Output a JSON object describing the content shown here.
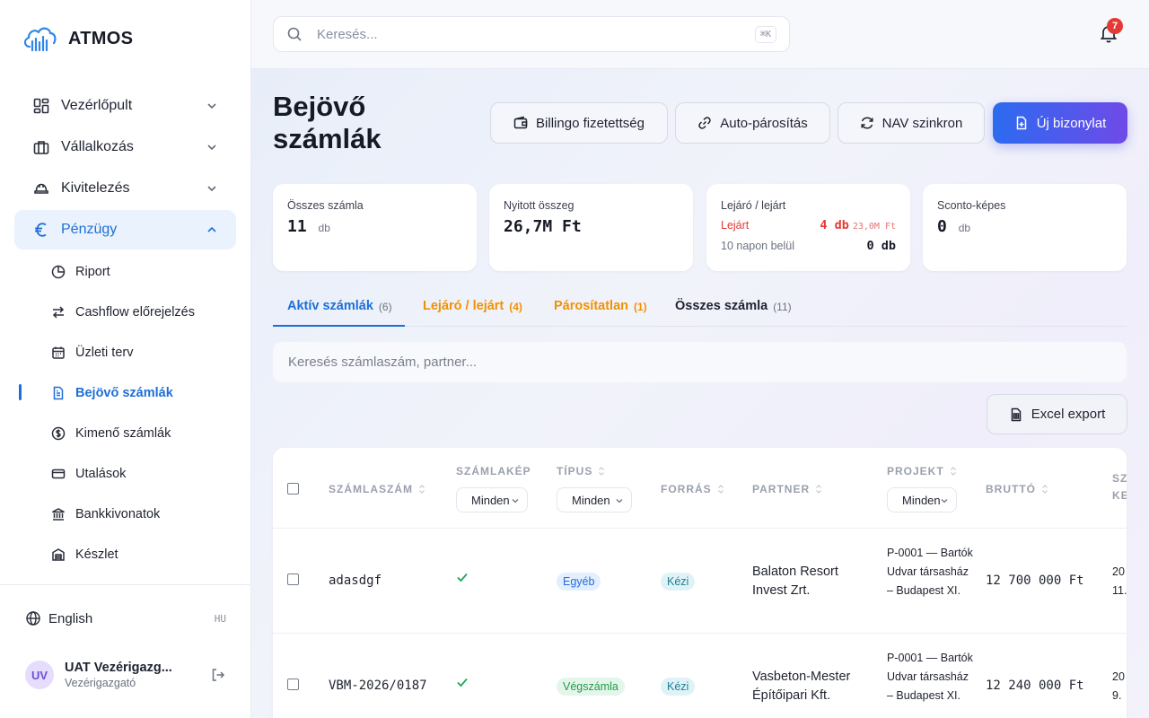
{
  "app": {
    "name": "ATMOS"
  },
  "sidebar": {
    "nav": [
      {
        "label": "Vezérlőpult"
      },
      {
        "label": "Vállalkozás"
      },
      {
        "label": "Kivitelezés"
      },
      {
        "label": "Pénzügy"
      }
    ],
    "sub": [
      {
        "label": "Riport"
      },
      {
        "label": "Cashflow előrejelzés"
      },
      {
        "label": "Üzleti terv"
      },
      {
        "label": "Bejövő számlák"
      },
      {
        "label": "Kimenő számlák"
      },
      {
        "label": "Utalások"
      },
      {
        "label": "Bankkivonatok"
      },
      {
        "label": "Készlet"
      }
    ],
    "language": {
      "label": "English",
      "code": "HU"
    },
    "user": {
      "initials": "UV",
      "name": "UAT Vezérigazg...",
      "role": "Vezérigazgató"
    }
  },
  "topbar": {
    "search_placeholder": "Keresés...",
    "shortcut": "⌘K",
    "notifications": "7"
  },
  "page": {
    "title": "Bejövő számlák",
    "buttons": {
      "billingo": "Billingo fizetettség",
      "auto": "Auto-párosítás",
      "nav": "NAV szinkron",
      "new": "Új bizonylat"
    }
  },
  "cards": {
    "total": {
      "label": "Összes számla",
      "value": "11",
      "unit": "db"
    },
    "open": {
      "label": "Nyitott összeg",
      "value": "26,7M Ft"
    },
    "due": {
      "label": "Lejáró / lejárt",
      "expired_label": "Lejárt",
      "expired_value": "4 db",
      "expired_amount": "23,0M Ft",
      "soon_label": "10 napon belül",
      "soon_value": "0 db"
    },
    "sconto": {
      "label": "Sconto-képes",
      "value": "0",
      "unit": "db"
    }
  },
  "tabs": [
    {
      "label": "Aktív számlák",
      "count": "(6)"
    },
    {
      "label": "Lejáró / lejárt",
      "count": "(4)"
    },
    {
      "label": "Párosítatlan",
      "count": "(1)"
    },
    {
      "label": "Összes számla",
      "count": "(11)"
    }
  ],
  "filter": {
    "placeholder": "Keresés számlaszám, partner..."
  },
  "export_label": "Excel export",
  "table": {
    "headers": {
      "number": "SZÁMLASZÁM",
      "image": "SZÁMLAKÉP",
      "type": "TÍPUS",
      "source": "FORRÁS",
      "partner": "PARTNER",
      "project": "PROJEKT",
      "gross": "BRUTTÓ",
      "next": "SZ",
      "next2": "KE"
    },
    "filters": {
      "image": "Minden",
      "type": "Minden",
      "project": "Minden"
    },
    "rows": [
      {
        "number": "adasdgf",
        "type": "Egyéb",
        "source": "Kézi",
        "partner": "Balaton Resort Invest Zrt.",
        "project": "P-0001 — Bartók Udvar társasház – Budapest XI.",
        "gross": "12 700 000 Ft",
        "date1": "20",
        "date2": "11."
      },
      {
        "number": "VBM-2026/0187",
        "type": "Végszámla",
        "source": "Kézi",
        "partner": "Vasbeton-Mester Építőipari Kft.",
        "project": "P-0001 — Bartók Udvar társasház – Budapest XI.",
        "gross": "12 240 000 Ft",
        "date1": "20",
        "date2": "9."
      }
    ]
  }
}
